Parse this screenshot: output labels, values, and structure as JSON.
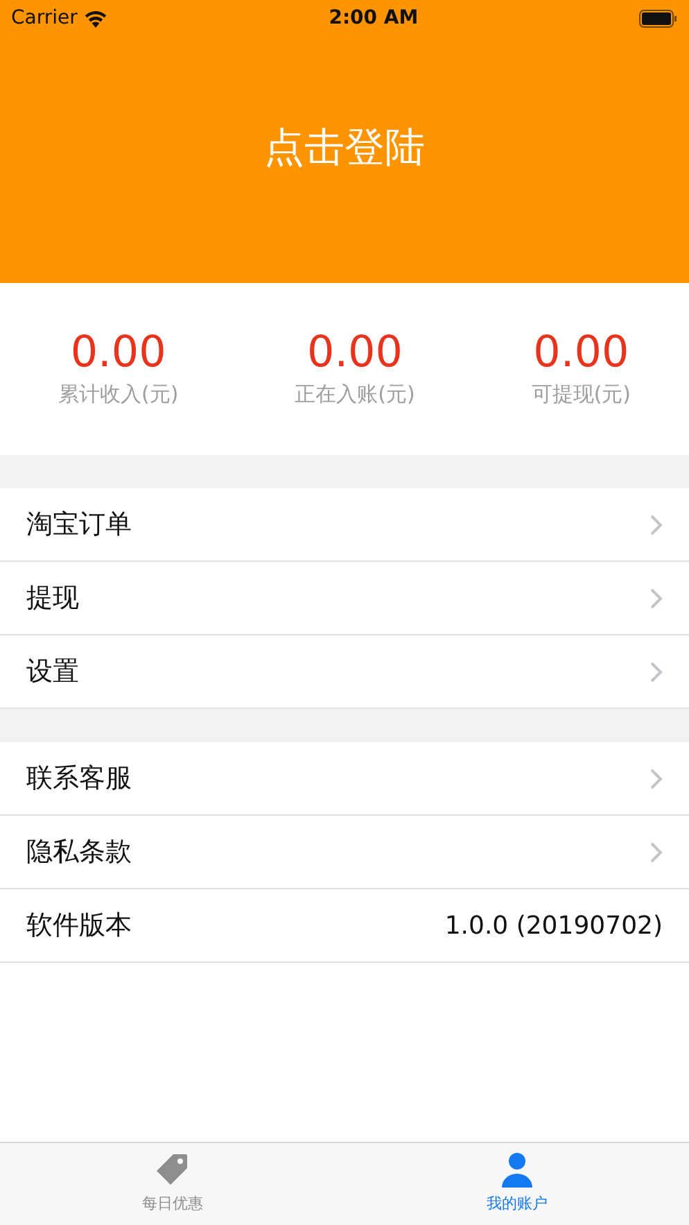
{
  "status_bar": {
    "carrier": "Carrier",
    "time": "2:00 AM"
  },
  "header": {
    "title": "点击登陆"
  },
  "stats": [
    {
      "value": "0.00",
      "label": "累计收入(元)"
    },
    {
      "value": "0.00",
      "label": "正在入账(元)"
    },
    {
      "value": "0.00",
      "label": "可提现(元)"
    }
  ],
  "sections": [
    [
      {
        "kind": "link",
        "label": "淘宝订单"
      },
      {
        "kind": "link",
        "label": "提现"
      },
      {
        "kind": "link",
        "label": "设置"
      }
    ],
    [
      {
        "kind": "link",
        "label": "联系客服"
      },
      {
        "kind": "link",
        "label": "隐私条款"
      },
      {
        "kind": "value",
        "label": "软件版本",
        "value": "1.0.0 (20190702)"
      }
    ]
  ],
  "tab_bar": [
    {
      "label": "每日优惠",
      "kind": "tag",
      "selected": false
    },
    {
      "label": "我的账户",
      "kind": "person",
      "selected": true
    }
  ]
}
